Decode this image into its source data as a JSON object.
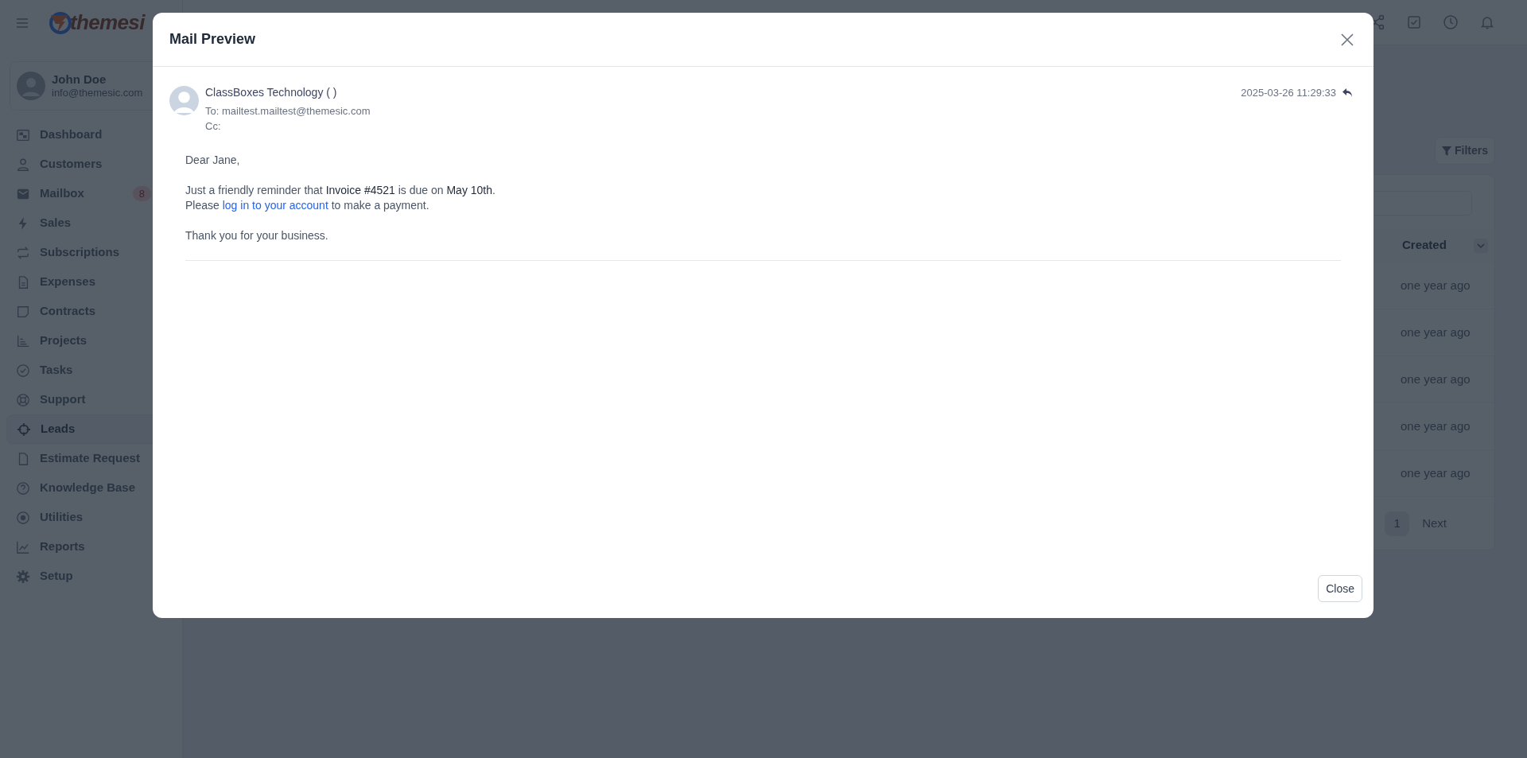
{
  "sidebar": {
    "logo": "themesi",
    "user": {
      "name": "John Doe",
      "email": "info@themesic.com"
    },
    "items": [
      {
        "label": "Dashboard",
        "selected": false
      },
      {
        "label": "Customers",
        "selected": false
      },
      {
        "label": "Mailbox",
        "selected": false,
        "badge": "8"
      },
      {
        "label": "Sales",
        "selected": false
      },
      {
        "label": "Subscriptions",
        "selected": false
      },
      {
        "label": "Expenses",
        "selected": false
      },
      {
        "label": "Contracts",
        "selected": false
      },
      {
        "label": "Projects",
        "selected": false
      },
      {
        "label": "Tasks",
        "selected": false
      },
      {
        "label": "Support",
        "selected": false
      },
      {
        "label": "Leads",
        "selected": true
      },
      {
        "label": "Estimate Request",
        "selected": false
      },
      {
        "label": "Knowledge Base",
        "selected": false
      },
      {
        "label": "Utilities",
        "selected": false
      },
      {
        "label": "Reports",
        "selected": false
      },
      {
        "label": "Setup",
        "selected": false
      }
    ]
  },
  "content": {
    "filters_button": "Filters",
    "table": {
      "columns": [
        "Created"
      ],
      "rows": [
        {
          "created": "one year ago"
        },
        {
          "created": "one year ago"
        },
        {
          "created": "one year ago"
        },
        {
          "created": "one year ago"
        },
        {
          "created": "one year ago"
        }
      ]
    },
    "pagination": {
      "pages": [
        {
          "label": "1",
          "selected": true
        }
      ],
      "next": "Next"
    }
  },
  "modal": {
    "title": "Mail Preview",
    "sender": "ClassBoxes Technology ( )",
    "to": "To: mailtest.mailtest@themesic.com",
    "cc": "Cc:",
    "date": "2025-03-26 11:29:33",
    "body": [
      [
        [
          {
            "text": "Dear Jane,"
          }
        ]
      ],
      [
        [
          {
            "text": "Just a friendly reminder that **Invoice #4521** is due on **May 10th**."
          }
        ],
        [
          {
            "text": "Please "
          },
          {
            "text": "log in to your account",
            "kind": "link"
          },
          {
            "text": " to make a payment."
          }
        ]
      ],
      [
        [
          {
            "text": "Thank you for your business."
          }
        ]
      ]
    ],
    "close_button": "Close"
  }
}
